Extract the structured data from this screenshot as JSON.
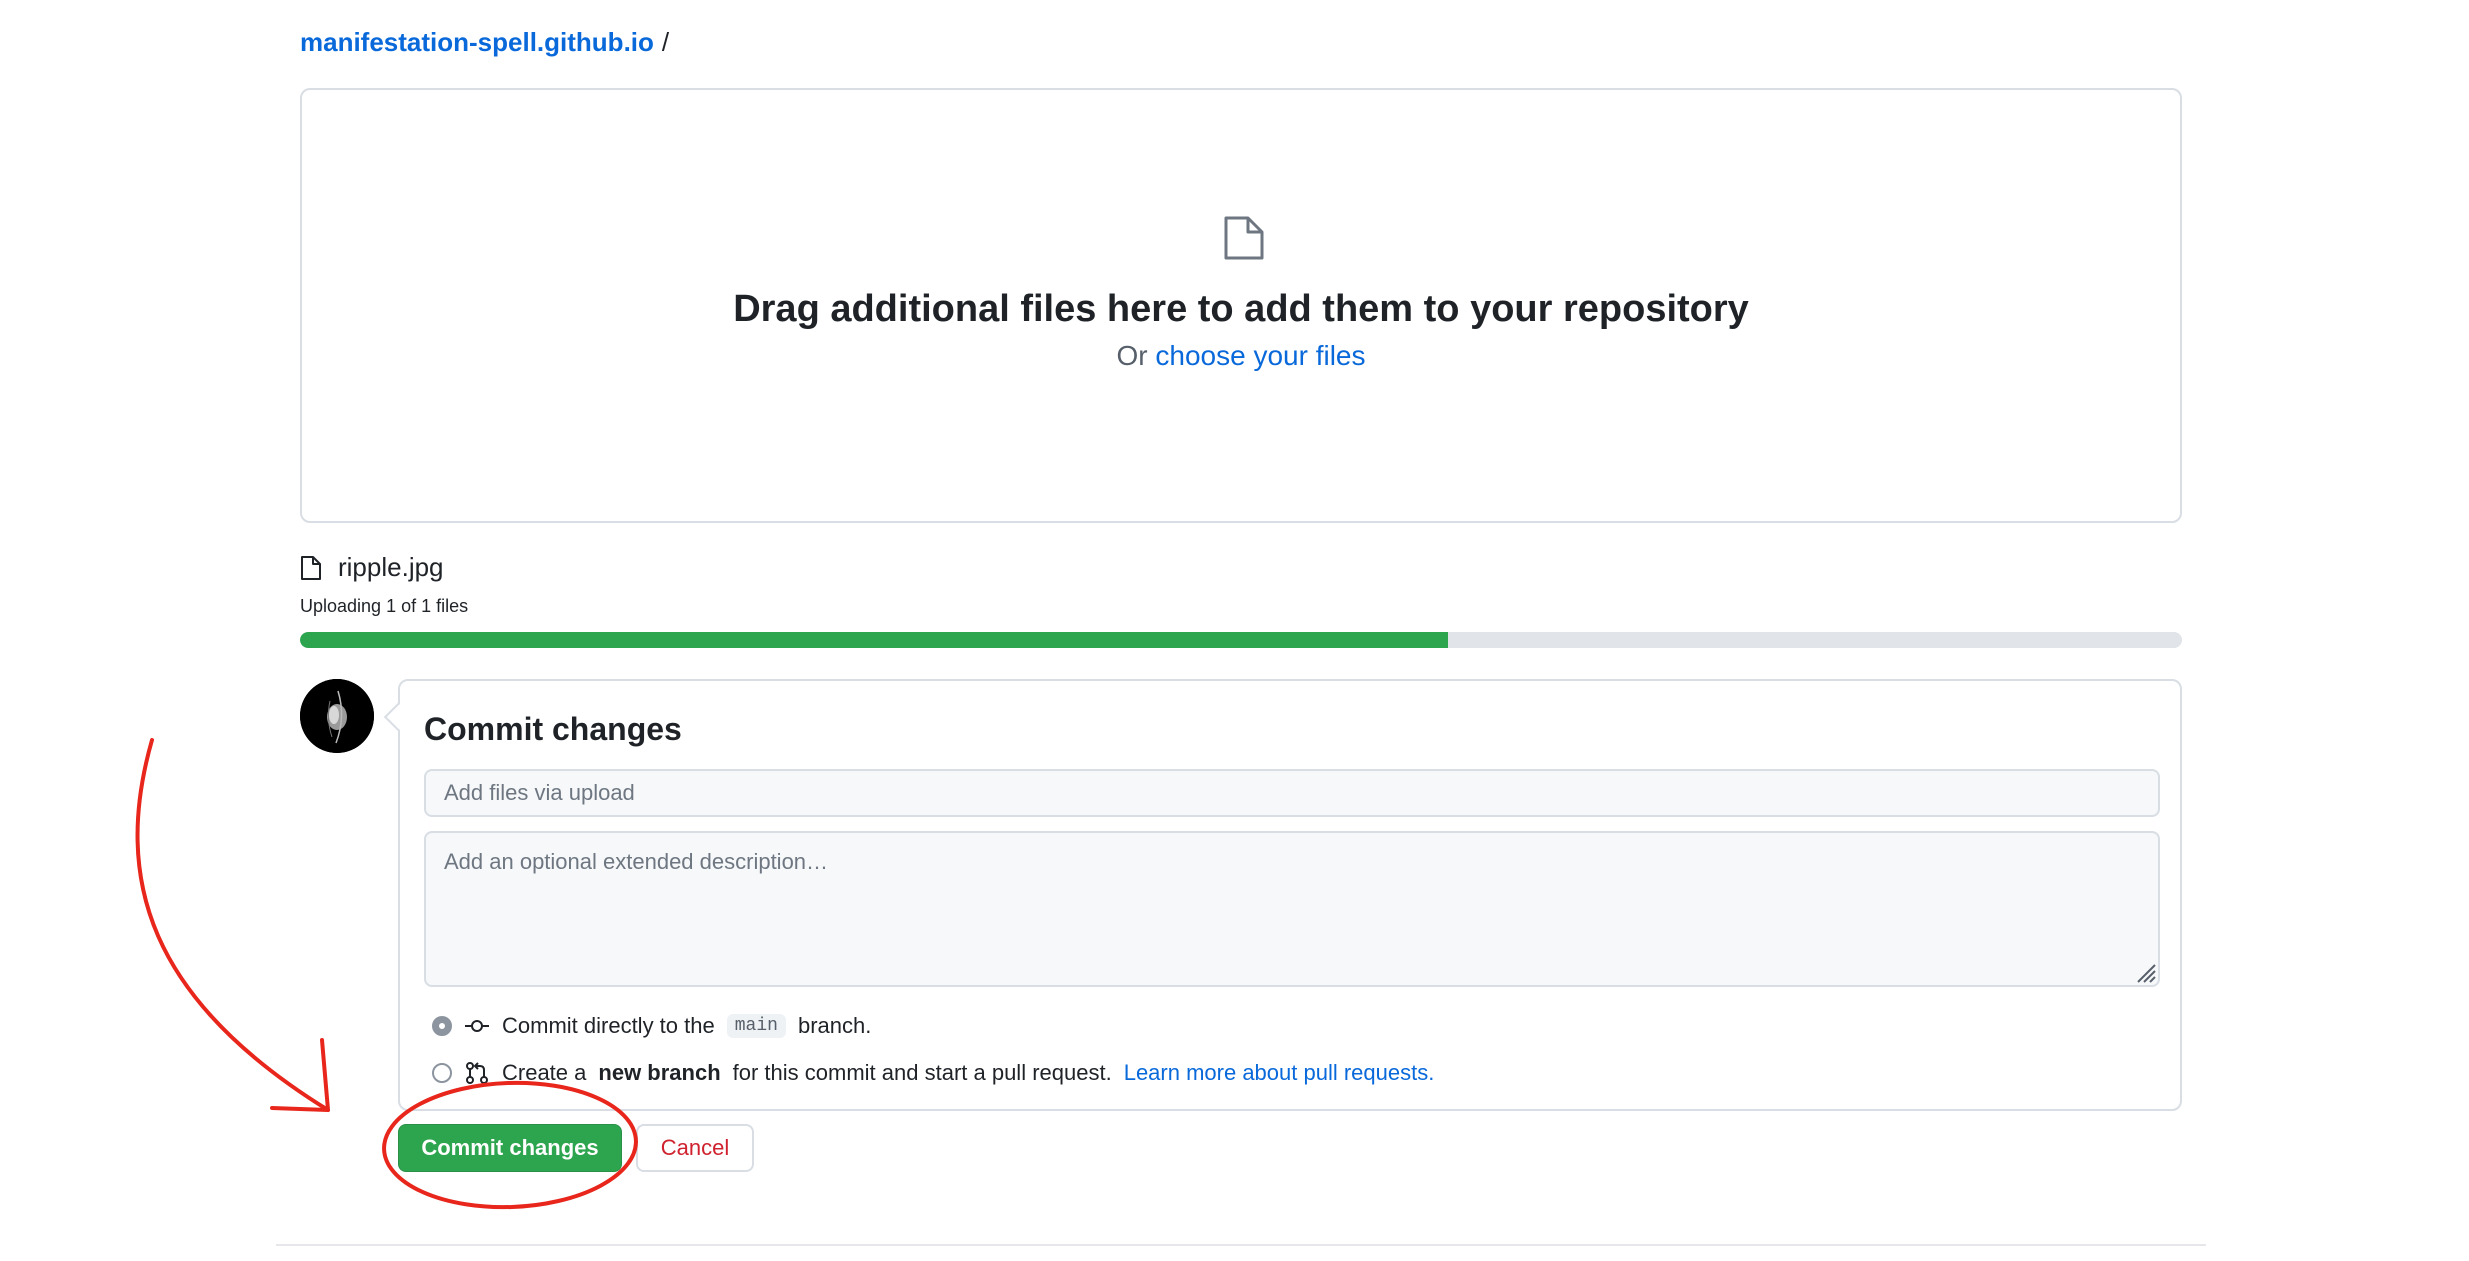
{
  "breadcrumb": {
    "repo": "manifestation-spell.github.io",
    "separator": "/"
  },
  "dropzone": {
    "icon": "file-icon",
    "title": "Drag additional files here to add them to your repository",
    "prefix": "Or",
    "link": "choose your files"
  },
  "upload": {
    "file_name": "ripple.jpg",
    "status": "Uploading 1 of 1 files",
    "progress_fraction": 0.61,
    "progress_color": "#2da44e"
  },
  "commit": {
    "title": "Commit changes",
    "summary_placeholder": "Add files via upload",
    "description_placeholder": "Add an optional extended description…",
    "option_direct": {
      "prefix": "Commit directly to the",
      "branch": "main",
      "suffix": "branch.",
      "selected": true
    },
    "option_new_branch": {
      "prefix": "Create a",
      "bold": "new branch",
      "suffix": "for this commit and start a pull request.",
      "link": "Learn more about pull requests.",
      "selected": false
    }
  },
  "actions": {
    "commit_label": "Commit changes",
    "cancel_label": "Cancel",
    "commit_color": "#2da44e",
    "cancel_color": "#cf222e"
  },
  "annotation": {
    "color": "#e8261c"
  }
}
